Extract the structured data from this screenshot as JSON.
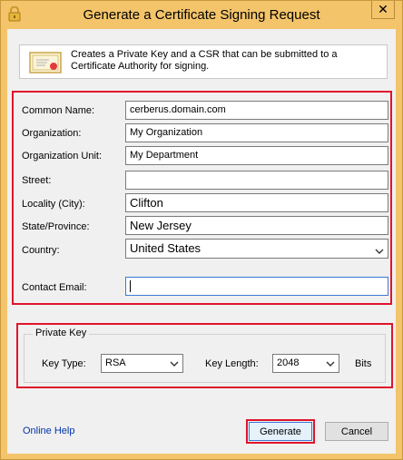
{
  "window": {
    "title": "Generate a Certificate Signing Request",
    "close_glyph": "✕"
  },
  "info": {
    "text": "Creates a Private Key and a CSR that can be submitted to a Certificate Authority for signing."
  },
  "fields": {
    "common_name": {
      "label": "Common Name:",
      "value": "cerberus.domain.com"
    },
    "organization": {
      "label": "Organization:",
      "value": "My Organization"
    },
    "organization_unit": {
      "label": "Organization Unit:",
      "value": "My Department"
    },
    "street": {
      "label": "Street:",
      "value": ""
    },
    "locality": {
      "label": "Locality (City):",
      "value": "Clifton"
    },
    "state": {
      "label": "State/Province:",
      "value": "New Jersey"
    },
    "country": {
      "label": "Country:",
      "value": "United States"
    },
    "contact_email": {
      "label": "Contact Email:",
      "value": ""
    }
  },
  "private_key": {
    "legend": "Private Key",
    "key_type_label": "Key Type:",
    "key_type_value": "RSA",
    "key_length_label": "Key Length:",
    "key_length_value": "2048",
    "bits_label": "Bits"
  },
  "footer": {
    "help_link": "Online Help",
    "generate_label": "Generate",
    "cancel_label": "Cancel"
  },
  "colors": {
    "title_bar": "#f3c46a",
    "highlight": "#e0142b",
    "link": "#0033aa"
  },
  "icons": {
    "title": "lock-icon",
    "info": "certificate-icon",
    "dropdown": "chevron-down-icon"
  }
}
